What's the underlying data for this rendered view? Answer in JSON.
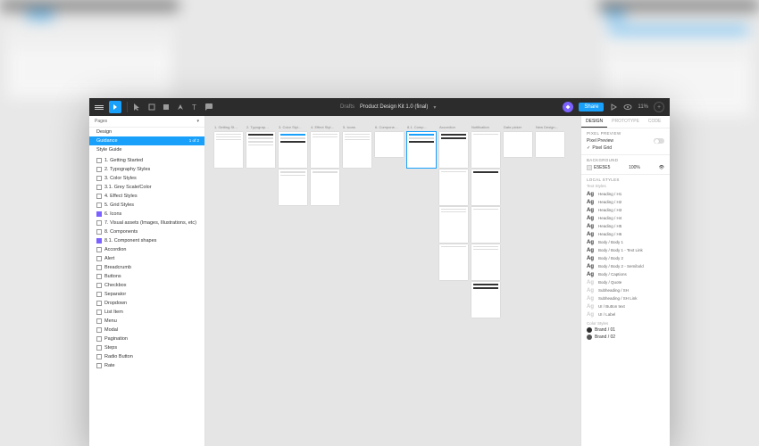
{
  "toolbar": {
    "location": "Drafts",
    "file_name": "Product Design Kit 1.0 (final)",
    "chevron": "▾",
    "share_label": "Share",
    "zoom": "11%"
  },
  "left_panel": {
    "pages_header": "Pages",
    "pages": [
      {
        "name": "Design",
        "selected": false
      },
      {
        "name": "Guidance",
        "selected": true,
        "badge": "1 of 2"
      },
      {
        "name": "Style Guide",
        "selected": false
      }
    ],
    "layers": [
      {
        "name": "1. Getting Started",
        "icon": "frame"
      },
      {
        "name": "2. Typography Styles",
        "icon": "frame"
      },
      {
        "name": "3. Color Styles",
        "icon": "frame"
      },
      {
        "name": "3.1. Grey Scale/Color",
        "icon": "frame"
      },
      {
        "name": "4. Effect Styles",
        "icon": "frame"
      },
      {
        "name": "5. Grid Styles",
        "icon": "frame"
      },
      {
        "name": "6. Icons",
        "icon": "frame-filled"
      },
      {
        "name": "7. Visual assets (Images, Illustrations, etc)",
        "icon": "frame"
      },
      {
        "name": "8. Components",
        "icon": "frame"
      },
      {
        "name": "8.1. Component shapes",
        "icon": "frame-filled"
      },
      {
        "name": "Accordion",
        "icon": "frame"
      },
      {
        "name": "Alert",
        "icon": "frame"
      },
      {
        "name": "Breadcrumb",
        "icon": "frame"
      },
      {
        "name": "Buttons",
        "icon": "frame"
      },
      {
        "name": "Checkbox",
        "icon": "frame"
      },
      {
        "name": "Separator",
        "icon": "frame"
      },
      {
        "name": "Dropdown",
        "icon": "frame"
      },
      {
        "name": "List Item",
        "icon": "frame"
      },
      {
        "name": "Menu",
        "icon": "frame"
      },
      {
        "name": "Modal",
        "icon": "frame"
      },
      {
        "name": "Pagination",
        "icon": "frame"
      },
      {
        "name": "Steps",
        "icon": "frame"
      },
      {
        "name": "Radio Button",
        "icon": "frame"
      },
      {
        "name": "Rate",
        "icon": "frame"
      }
    ]
  },
  "canvas": {
    "frame_labels": [
      "1. Getting St…",
      "2. Typograp…",
      "3. Color Styl…",
      "4. Effect Styl…",
      "5. Icons",
      "6. Compone…",
      "8.1. Comp…",
      "Accordion",
      "Notification",
      "Date picker",
      "New Design…"
    ]
  },
  "right_panel": {
    "tabs": [
      "DESIGN",
      "PROTOTYPE",
      "CODE"
    ],
    "pixel_preview": {
      "title": "PIXEL PREVIEW",
      "label": "Pixel Preview",
      "grid_label": "Pixel Grid"
    },
    "background": {
      "title": "BACKGROUND",
      "hex": "E5E5E5",
      "opacity": "100%"
    },
    "local_styles": {
      "title": "LOCAL STYLES",
      "text_group": "Text Styles",
      "color_group": "Color Styles",
      "text_styles": [
        {
          "ag": "Ag",
          "label": "Heading / H1"
        },
        {
          "ag": "Ag",
          "label": "Heading / H2"
        },
        {
          "ag": "Ag",
          "label": "Heading / H3"
        },
        {
          "ag": "Ag",
          "label": "Heading / H4"
        },
        {
          "ag": "Ag",
          "label": "Heading / H5"
        },
        {
          "ag": "Ag",
          "label": "Heading / H6"
        },
        {
          "ag": "Ag",
          "label": "Body / Body 1"
        },
        {
          "ag": "Ag",
          "label": "Body / Body 1 - Text Link"
        },
        {
          "ag": "Ag",
          "label": "Body / Body 2"
        },
        {
          "ag": "Ag",
          "label": "Body / Body 2 - Semibold"
        },
        {
          "ag": "Ag",
          "label": "Body / Captions"
        },
        {
          "ag": "Ag",
          "label": "Body / Quote"
        },
        {
          "ag": "Ag",
          "label": "Subheading / SH"
        },
        {
          "ag": "Ag",
          "label": "Subheading / SH Link"
        },
        {
          "ag": "Ag",
          "label": "UI / Button text"
        },
        {
          "ag": "Ag",
          "label": "UI / Label"
        }
      ],
      "color_styles": [
        {
          "color": "#2c2c2c",
          "label": "Brand / 01"
        },
        {
          "color": "#555555",
          "label": "Brand / 02"
        }
      ]
    }
  }
}
